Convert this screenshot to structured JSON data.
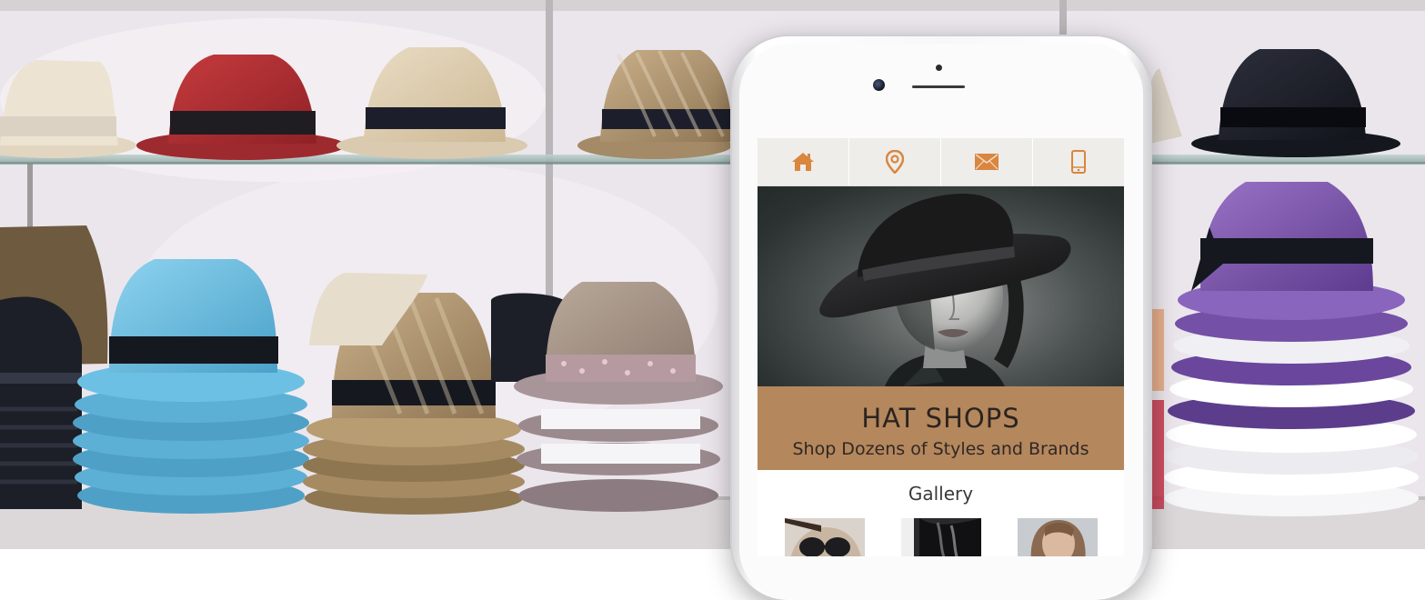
{
  "app": {
    "nav": {
      "items": [
        {
          "icon": "home-icon"
        },
        {
          "icon": "location-pin-icon"
        },
        {
          "icon": "envelope-icon"
        },
        {
          "icon": "mobile-phone-icon"
        }
      ],
      "accent_color": "#d9863f"
    },
    "hero": {
      "title": "HAT SHOPS",
      "subtitle": "Shop Dozens of Styles and Brands",
      "banner_color": "#b5875d"
    },
    "gallery": {
      "title": "Gallery",
      "thumbnails": [
        {
          "icon": "gallery-thumbnail-sunglasses"
        },
        {
          "icon": "gallery-thumbnail-braids"
        },
        {
          "icon": "gallery-thumbnail-portrait"
        }
      ]
    }
  }
}
